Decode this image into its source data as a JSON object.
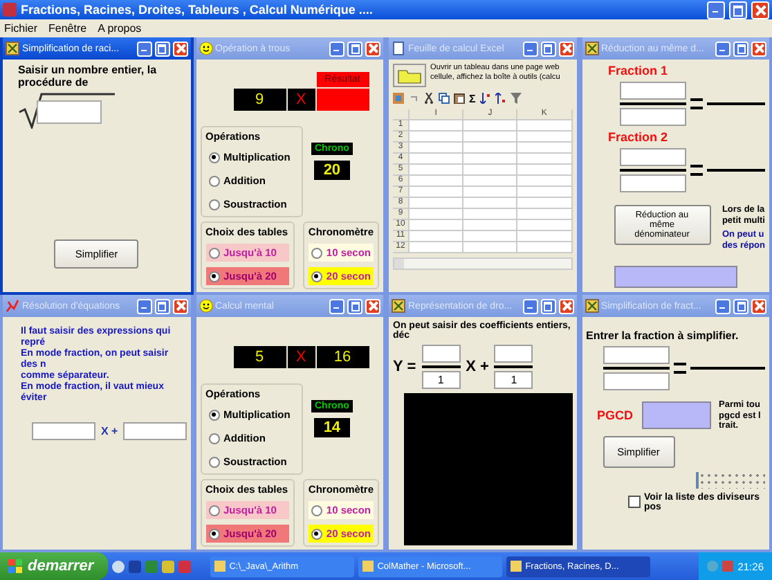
{
  "app": {
    "title": "Fractions, Racines, Droites, Tableurs , Calcul Numérique ....",
    "menu": [
      "Fichier",
      "Fenêtre",
      "A propos"
    ]
  },
  "windows": [
    {
      "kind": "sqrt",
      "title": "Simplification de raci...",
      "active": true,
      "prompt": "Saisir un nombre entier, la procédure de",
      "button": "Simplifier"
    },
    {
      "kind": "quiz",
      "title": "Opération à trous",
      "active": false,
      "result_label": "Résultat",
      "cells": [
        {
          "kind": "number",
          "text": "9"
        },
        {
          "kind": "operator",
          "text": "X"
        },
        {
          "kind": "blank"
        }
      ],
      "operations": {
        "label": "Opérations",
        "options": [
          {
            "label": "Multiplication",
            "selected": true
          },
          {
            "label": "Addition",
            "selected": false
          },
          {
            "label": "Soustraction",
            "selected": false
          }
        ]
      },
      "chrono_label": "Chrono",
      "chrono_value": "20",
      "tables": {
        "label": "Choix des tables",
        "options": [
          {
            "label": "Jusqu'à 10",
            "selected": false
          },
          {
            "label": "Jusqu'à 20",
            "selected": true
          }
        ]
      },
      "timer": {
        "label": "Chronomètre",
        "options": [
          {
            "label": "10 secon",
            "selected": false
          },
          {
            "label": "20 secon",
            "selected": true
          }
        ]
      }
    },
    {
      "kind": "sheet",
      "title": "Feuille de calcul Excel",
      "active": false,
      "lines": [
        "Ouvrir un tableau dans une page web",
        "cellule, affichez la boîte à outils (calcu"
      ],
      "sum_symbol": "Σ",
      "columns": [
        "I",
        "J",
        "K"
      ],
      "rows": [
        "1",
        "2",
        "3",
        "4",
        "5",
        "6",
        "7",
        "8",
        "9",
        "10",
        "11",
        "12"
      ]
    },
    {
      "kind": "reduce",
      "title": "Réduction au même d...",
      "active": false,
      "fractions": [
        "Fraction 1",
        "Fraction 2"
      ],
      "button": "Réduction au même dénominateur",
      "notes": [
        "Lors de la",
        "petit multi"
      ],
      "notes_blue": [
        "On peut u",
        "des répon"
      ]
    },
    {
      "kind": "eq",
      "title": "Résolution d'équations",
      "active": false,
      "lines": [
        "Il faut saisir des expressions qui repré",
        "En mode fraction, on peut saisir des n",
        "comme séparateur.",
        "En mode fraction, il vaut mieux éviter"
      ],
      "operator": "X +"
    },
    {
      "kind": "quiz",
      "title": "Calcul mental",
      "active": false,
      "cells": [
        {
          "kind": "number",
          "text": "5"
        },
        {
          "kind": "operator",
          "text": "X"
        },
        {
          "kind": "number",
          "text": "16"
        }
      ],
      "operations": {
        "label": "Opérations",
        "options": [
          {
            "label": "Multiplication",
            "selected": true
          },
          {
            "label": "Addition",
            "selected": false
          },
          {
            "label": "Soustraction",
            "selected": false
          }
        ]
      },
      "chrono_label": "Chrono",
      "chrono_value": "14",
      "tables": {
        "label": "Choix des tables",
        "options": [
          {
            "label": "Jusqu'à 10",
            "selected": false
          },
          {
            "label": "Jusqu'à 20",
            "selected": true
          }
        ]
      },
      "timer": {
        "label": "Chronomètre",
        "options": [
          {
            "label": "10 secon",
            "selected": false
          },
          {
            "label": "20 secon",
            "selected": true
          }
        ]
      }
    },
    {
      "kind": "line",
      "title": "Représentation de dro...",
      "active": false,
      "prompt": "On peut saisir des coefficients entiers, déc",
      "y_label": "Y =",
      "x_label": "X +",
      "denominators": [
        "1",
        "1"
      ]
    },
    {
      "kind": "simp",
      "title": "Simplification de fract...",
      "active": false,
      "prompt": "Entrer la fraction à simplifier.",
      "pgcd_label": "PGCD",
      "notes": [
        "Parmi tou",
        "pgcd est l",
        "trait."
      ],
      "button": "Simplifier",
      "checkbox": {
        "label": "Voir la liste des diviseurs pos",
        "checked": false
      }
    }
  ],
  "taskbar": {
    "start": "demarrer",
    "tasks": [
      {
        "label": "C:\\_Java\\_Arithm",
        "selected": false
      },
      {
        "label": "ColMather - Microsoft...",
        "selected": false
      },
      {
        "label": "Fractions, Racines, D...",
        "selected": true
      }
    ],
    "clock": "21:26"
  }
}
